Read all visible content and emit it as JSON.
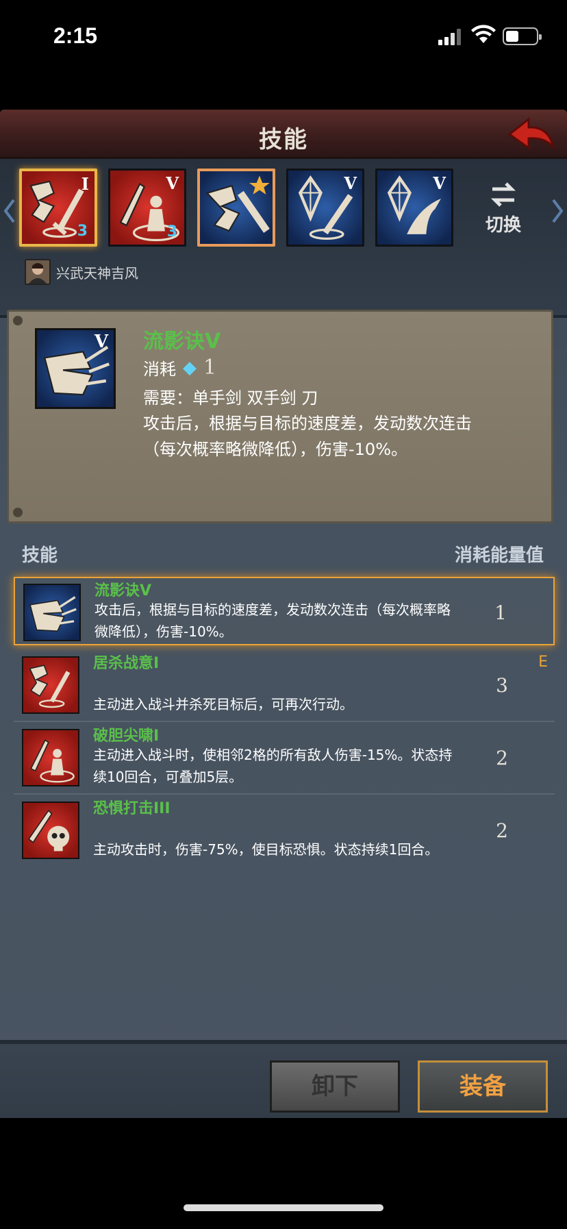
{
  "status_bar": {
    "time": "2:15"
  },
  "header": {
    "title": "技能"
  },
  "skill_slots": [
    {
      "name": "居杀战意",
      "roman": "I",
      "gems": "3",
      "bg": "#c42a23",
      "selected": true
    },
    {
      "name": "破胆尖啸",
      "roman": "V",
      "gems": "3",
      "bg": "#c42a23"
    },
    {
      "name": "empty-weapon-slot",
      "roman": "",
      "star": true,
      "bg": "#2e5ea8"
    },
    {
      "name": "blue-skill-4",
      "roman": "V",
      "bg": "#2e5ea8"
    },
    {
      "name": "blue-skill-5",
      "roman": "V",
      "bg": "#2e5ea8"
    }
  ],
  "switch": {
    "label": "切换"
  },
  "owner": {
    "name": "兴武天神吉风"
  },
  "detail": {
    "name": "流影诀V",
    "roman": "V",
    "cost_label": "消耗",
    "cost_value": "1",
    "requirement": "需要：单手剑  双手剑  刀",
    "desc_line1": "攻击后，根据与目标的速度差，发动数次连击",
    "desc_line2": "（每次概率略微降低），伤害-10%。"
  },
  "list_header": {
    "left": "技能",
    "right": "消耗能量值"
  },
  "skills": [
    {
      "name": "流影诀V",
      "desc1": "攻击后，根据与目标的速度差，发动数次连击（每次概率略",
      "desc2": "微降低），伤害-10%。",
      "cost": "1",
      "color": "blue"
    },
    {
      "name": "居杀战意I",
      "desc1": "",
      "desc2": "主动进入战斗并杀死目标后，可再次行动。",
      "cost": "3",
      "color": "red"
    },
    {
      "name": "破胆尖啸I",
      "desc1": "主动进入战斗时，使相邻2格的所有敌人伤害-15%。状态持",
      "desc2": "续10回合，可叠加5层。",
      "cost": "2",
      "color": "red"
    },
    {
      "name": "恐惧打击III",
      "desc1": "",
      "desc2": "主动攻击时，伤害-75%，使目标恐惧。状态持续1回合。",
      "cost": "2",
      "color": "red"
    }
  ],
  "edge_mark": "E",
  "buttons": {
    "unequip": "卸下",
    "equip": "装备"
  }
}
